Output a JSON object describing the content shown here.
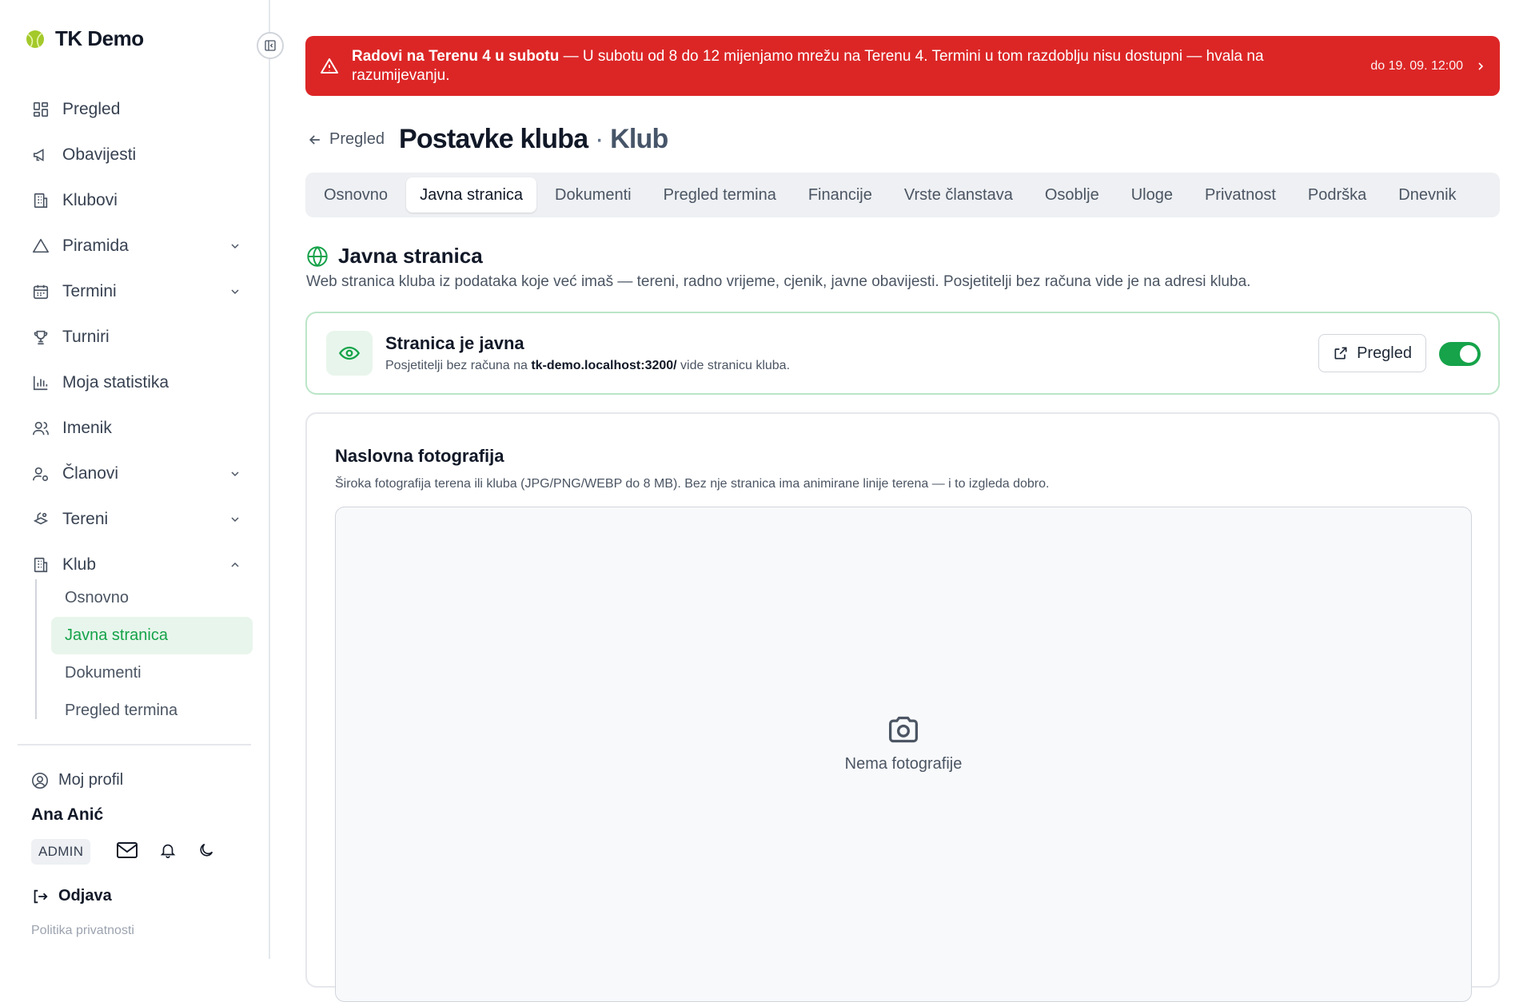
{
  "app": {
    "name": "TK Demo"
  },
  "sidebar": {
    "items": [
      {
        "label": "Pregled",
        "icon": "dashboard-icon"
      },
      {
        "label": "Obavijesti",
        "icon": "megaphone-icon"
      },
      {
        "label": "Klubovi",
        "icon": "building-icon"
      },
      {
        "label": "Piramida",
        "icon": "triangle-icon",
        "chevron": "down"
      },
      {
        "label": "Termini",
        "icon": "calendar-icon",
        "chevron": "down"
      },
      {
        "label": "Turniri",
        "icon": "trophy-icon"
      },
      {
        "label": "Moja statistika",
        "icon": "bar-chart-icon"
      },
      {
        "label": "Imenik",
        "icon": "users-icon"
      },
      {
        "label": "Članovi",
        "icon": "user-settings-icon",
        "chevron": "down"
      },
      {
        "label": "Tereni",
        "icon": "court-icon",
        "chevron": "down"
      },
      {
        "label": "Klub",
        "icon": "building-icon",
        "chevron": "up"
      }
    ],
    "sub_items": [
      "Osnovno",
      "Javna stranica",
      "Dokumenti",
      "Pregled termina"
    ],
    "active_sub": "Javna stranica",
    "profile_label": "Moj profil",
    "user_name": "Ana Anić",
    "role_badge": "ADMIN",
    "logout_label": "Odjava",
    "privacy_label": "Politika privatnosti"
  },
  "banner": {
    "title": "Radovi na Terenu 4 u subotu",
    "message": " — U subotu od 8 do 12 mijenjamo mrežu na Terenu 4. Termini u tom razdoblju nisu dostupni — hvala na razumijevanju.",
    "until": "do 19. 09. 12:00",
    "color": "#dc2626"
  },
  "header": {
    "back_label": "Pregled",
    "title": "Postavke kluba",
    "separator": "·",
    "subtitle": "Klub"
  },
  "tabs": [
    "Osnovno",
    "Javna stranica",
    "Dokumenti",
    "Pregled termina",
    "Financije",
    "Vrste članstava",
    "Osoblje",
    "Uloge",
    "Privatnost",
    "Podrška",
    "Dnevnik"
  ],
  "active_tab": "Javna stranica",
  "section": {
    "title": "Javna stranica",
    "description": "Web stranica kluba iz podataka koje već imaš — tereni, radno vrijeme, cjenik, javne obavijesti. Posjetitelji bez računa vide je na adresi kluba."
  },
  "public_card": {
    "title": "Stranica je javna",
    "desc_before": "Posjetitelji bez računa na ",
    "url": "tk-demo.localhost:3200/",
    "desc_after": " vide stranicu kluba.",
    "preview_label": "Pregled",
    "toggle_on": true,
    "accent": "#16a34a"
  },
  "photo": {
    "title": "Naslovna fotografija",
    "description": "Široka fotografija terena ili kluba (JPG/PNG/WEBP do 8 MB). Bez nje stranica ima animirane linije terena — i to izgleda dobro.",
    "empty_label": "Nema fotografije"
  }
}
